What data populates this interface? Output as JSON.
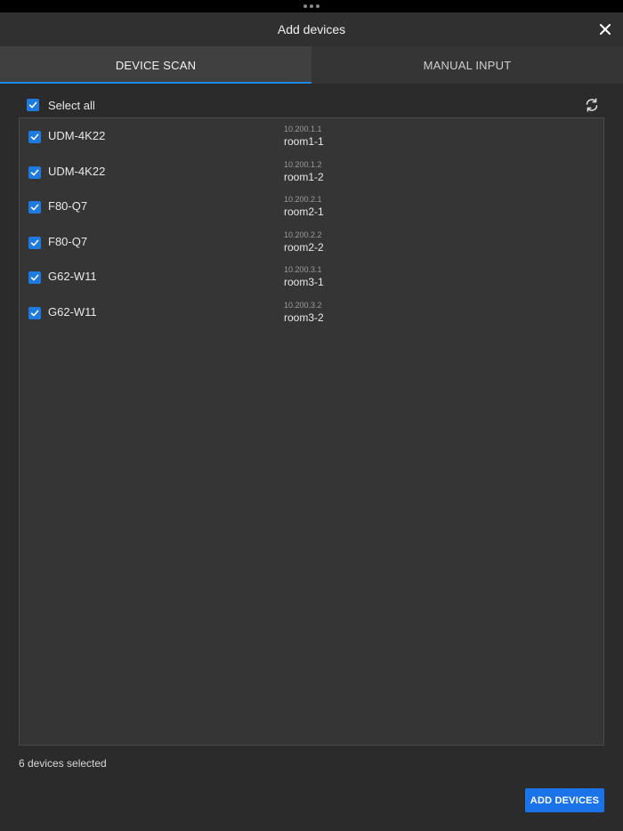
{
  "header": {
    "title": "Add devices",
    "close_icon": "close-icon"
  },
  "tabs": [
    {
      "label": "DEVICE SCAN",
      "active": true
    },
    {
      "label": "MANUAL INPUT",
      "active": false
    }
  ],
  "select_all": {
    "label": "Select all",
    "checked": true
  },
  "refresh_icon": "refresh-icon",
  "devices": [
    {
      "name": "UDM-4K22",
      "ip": "10.200.1.1",
      "room": "room1-1",
      "checked": true
    },
    {
      "name": "UDM-4K22",
      "ip": "10.200.1.2",
      "room": "room1-2",
      "checked": true
    },
    {
      "name": "F80-Q7",
      "ip": "10.200.2.1",
      "room": "room2-1",
      "checked": true
    },
    {
      "name": "F80-Q7",
      "ip": "10.200.2.2",
      "room": "room2-2",
      "checked": true
    },
    {
      "name": "G62-W11",
      "ip": "10.200.3.1",
      "room": "room3-1",
      "checked": true
    },
    {
      "name": "G62-W11",
      "ip": "10.200.3.2",
      "room": "room3-2",
      "checked": true
    }
  ],
  "footer": {
    "selected_text": "6 devices selected",
    "add_button_label": "ADD DEVICES"
  },
  "colors": {
    "accent": "#1a73e8",
    "background": "#2b2b2b"
  }
}
